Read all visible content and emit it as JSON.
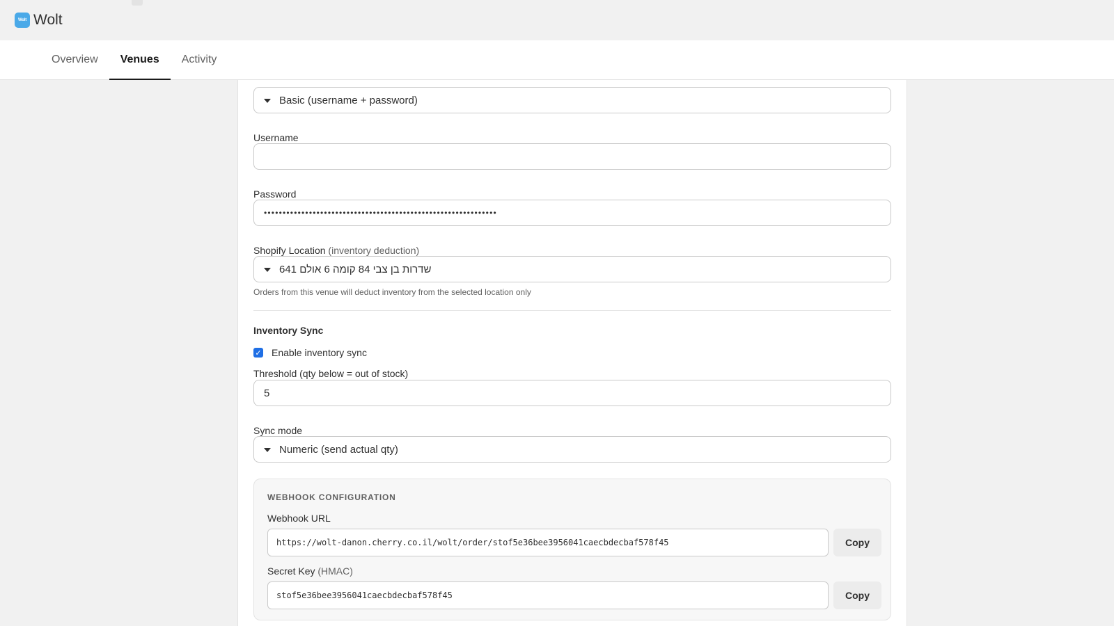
{
  "app": {
    "logo_text": "Wolt",
    "title": "Wolt"
  },
  "tabs": [
    {
      "label": "Overview",
      "active": false
    },
    {
      "label": "Venues",
      "active": true
    },
    {
      "label": "Activity",
      "active": false
    }
  ],
  "form": {
    "auth_type": {
      "selected": "Basic (username + password)"
    },
    "username": {
      "label": "Username",
      "value": ""
    },
    "password": {
      "label": "Password",
      "value": "••••••••••••••••••••••••••••••••••••••••••••••••••••••••••••••"
    },
    "location": {
      "label": "Shopify Location",
      "label_note": "(inventory deduction)",
      "selected": "שדרות בן צבי 84 קומה 6 אולם 641",
      "help": "Orders from this venue will deduct inventory from the selected location only"
    },
    "inventory_sync": {
      "title": "Inventory Sync",
      "enable_label": "Enable inventory sync",
      "enabled": true,
      "threshold_label": "Threshold (qty below = out of stock)",
      "threshold_value": "5",
      "mode_label": "Sync mode",
      "mode_selected": "Numeric (send actual qty)"
    },
    "webhook": {
      "title": "WEBHOOK CONFIGURATION",
      "url_label": "Webhook URL",
      "url_value": "https://wolt-danon.cherry.co.il/wolt/order/stof5e36bee3956041caecbdecbaf578f45",
      "secret_label": "Secret Key",
      "secret_note": "(HMAC)",
      "secret_value": "stof5e36bee3956041caecbdecbaf578f45",
      "copy_label": "Copy"
    }
  },
  "colors": {
    "accent": "#1f6fe5",
    "logo": "#4aa9e8",
    "background": "#f1f1f1"
  }
}
